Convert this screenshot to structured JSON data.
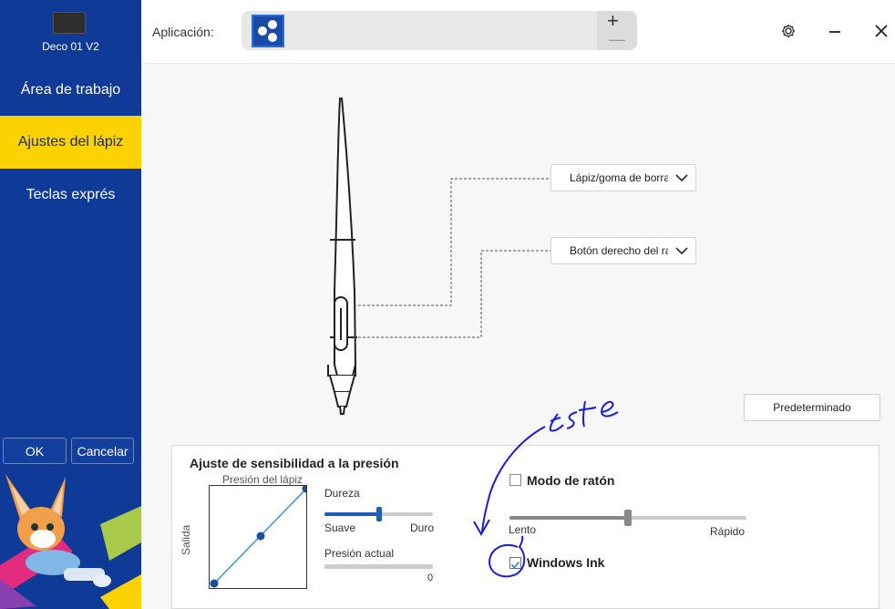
{
  "sidebar": {
    "device_name": "Deco 01 V2",
    "items": [
      {
        "label": "Área de trabajo",
        "active": false
      },
      {
        "label": "Ajustes del lápiz",
        "active": true
      },
      {
        "label": "Teclas exprés",
        "active": false
      }
    ],
    "ok_label": "OK",
    "cancel_label": "Cancelar"
  },
  "header": {
    "app_label": "Aplicación:",
    "plus": "+",
    "minus": "—",
    "icons": [
      "gear-icon",
      "minimize-icon",
      "close-icon"
    ]
  },
  "pen": {
    "upper_button_dropdown": "Lápiz/goma de borrar",
    "lower_button_dropdown": "Botón derecho del ratón"
  },
  "default_button": "Predeterminado",
  "pressure": {
    "title": "Ajuste de sensibilidad a la presión",
    "graph_top_label": "Presión del lápiz",
    "graph_side_label": "Salida",
    "hardness_label": "Dureza",
    "hardness_value": 0.5,
    "soft_label": "Suave",
    "hard_label": "Duro",
    "current_pressure_label": "Presión actual",
    "current_pressure_value": "0"
  },
  "mouse_mode": {
    "label": "Modo de ratón",
    "checked": false,
    "speed_value": 0.5,
    "slow_label": "Lento",
    "fast_label": "Rápido"
  },
  "windows_ink": {
    "label": "Windows Ink",
    "checked": true
  },
  "annotation": {
    "text": "este"
  },
  "colors": {
    "sidebar": "#0f3a97",
    "active_item": "#fcd200",
    "accent": "#1d5fb7",
    "annotation": "#1a1adb"
  }
}
